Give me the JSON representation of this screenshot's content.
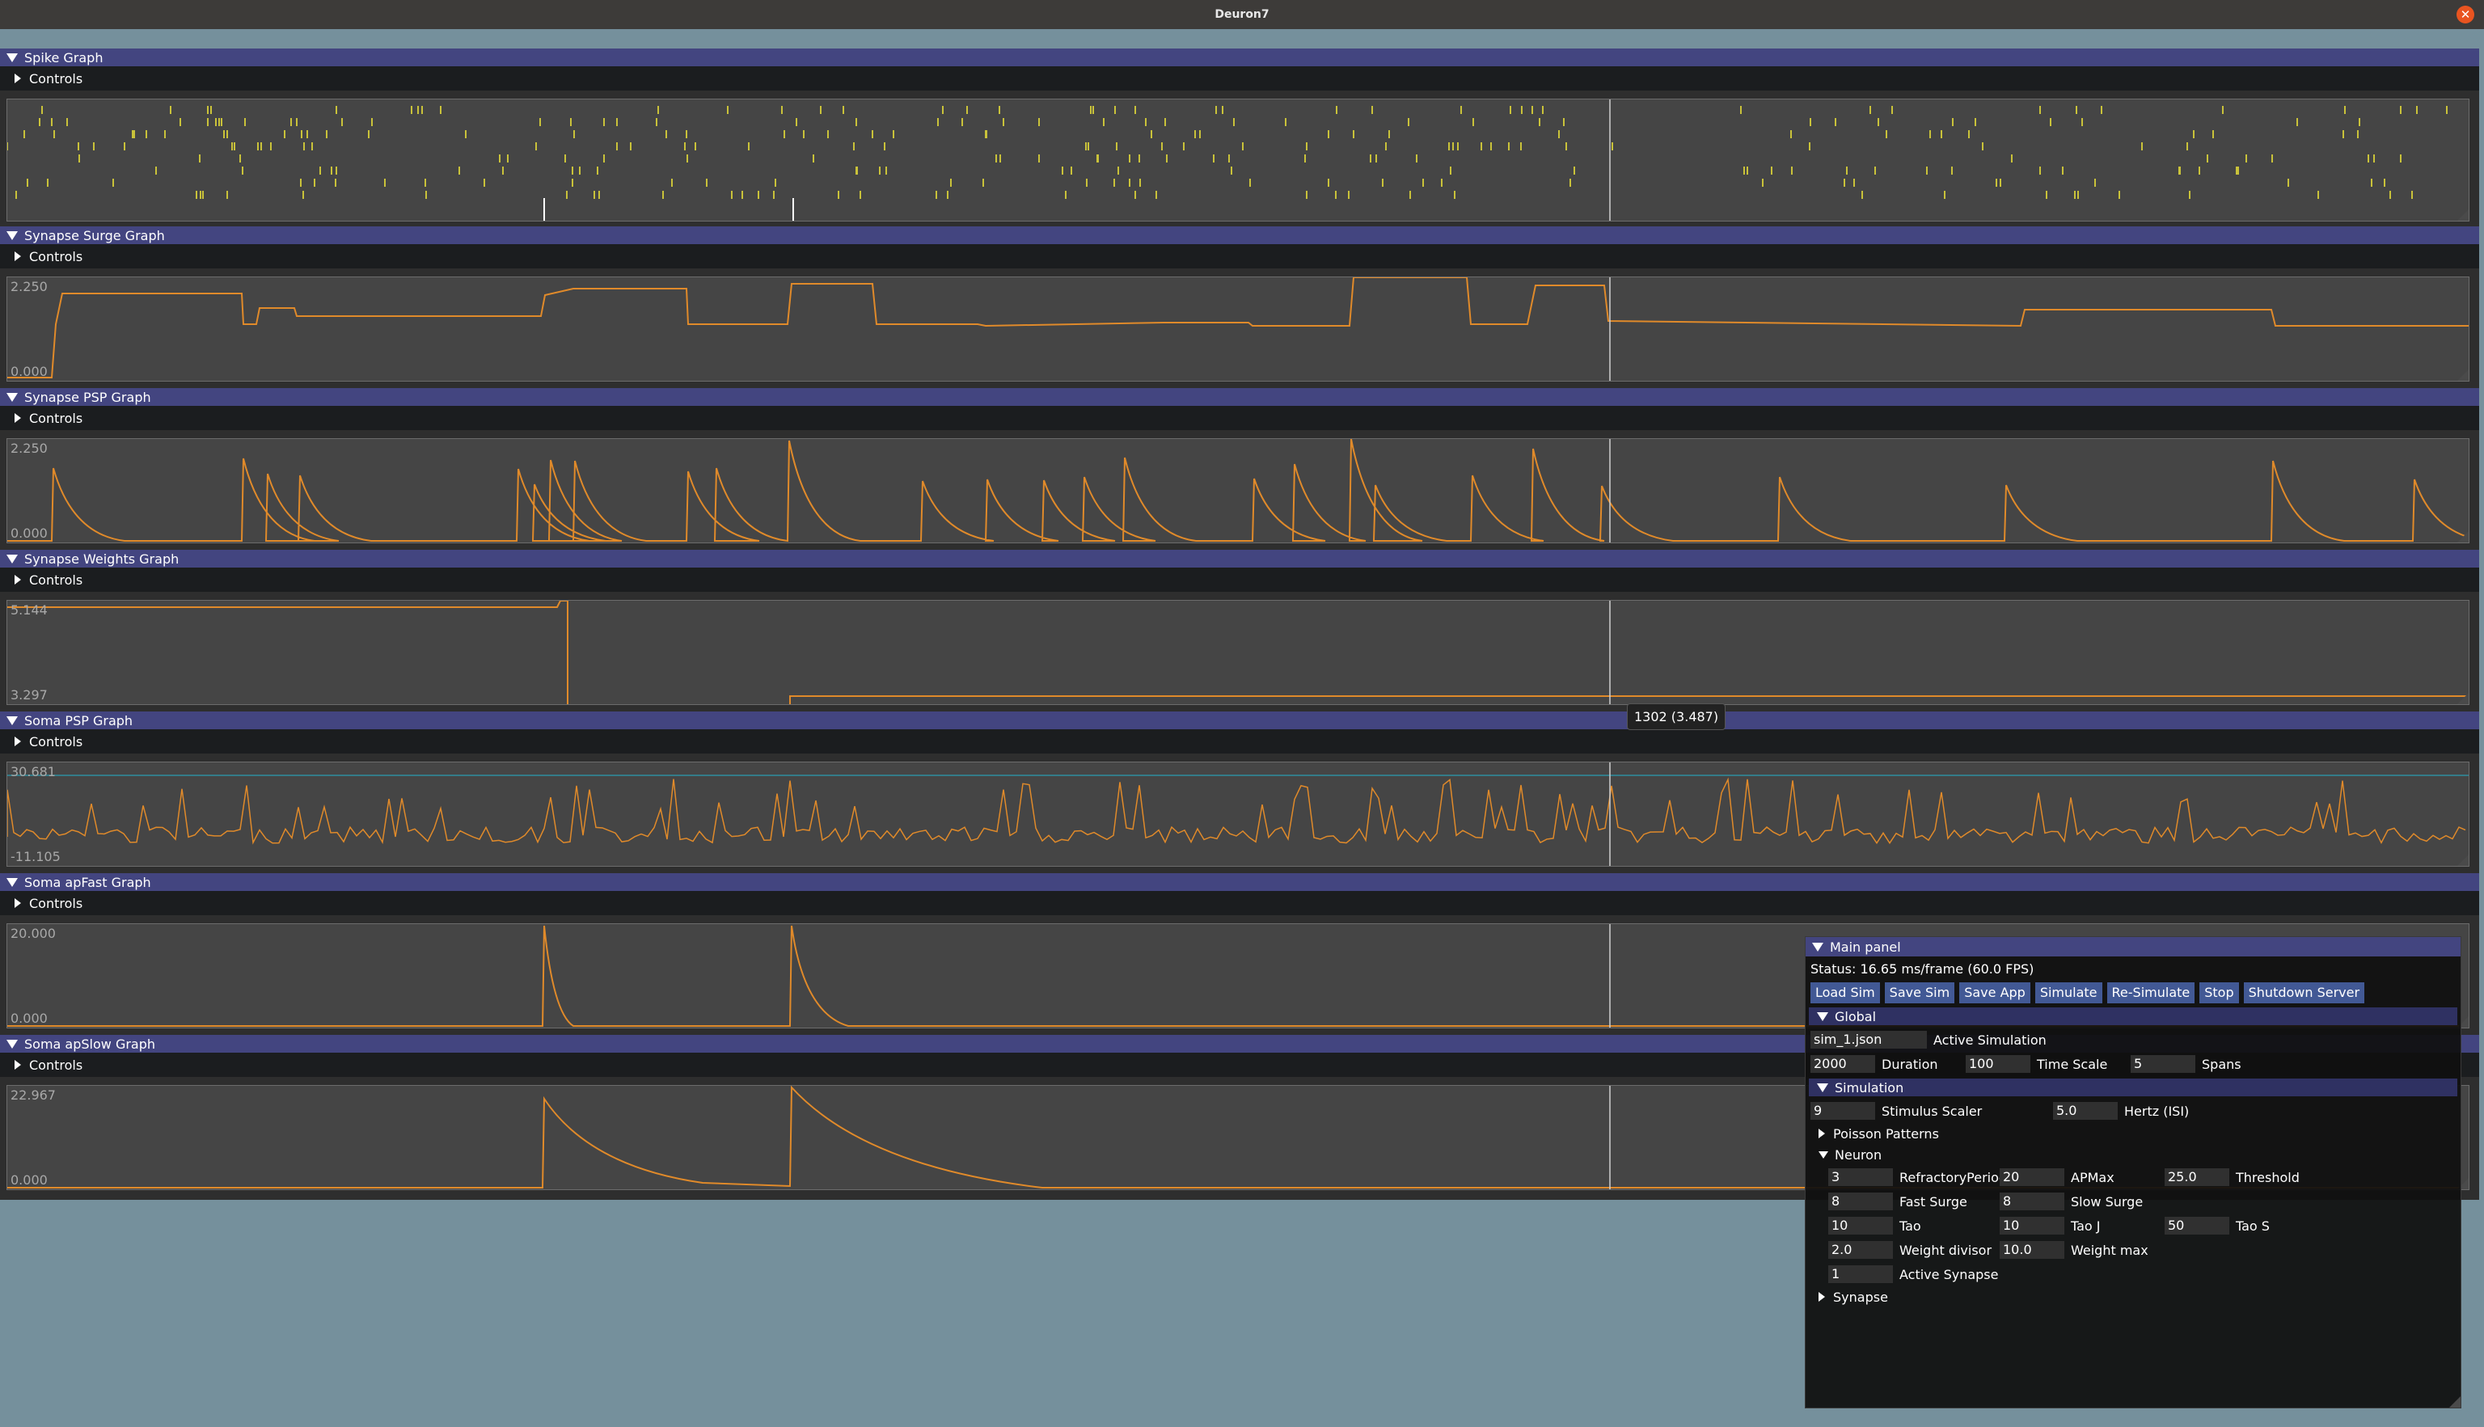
{
  "window": {
    "title": "Deuron7"
  },
  "graphs": [
    {
      "name": "spike-graph",
      "title": "Spike Graph",
      "controls": "Controls",
      "ymax": "",
      "ymin": "",
      "type": "spike",
      "height": 150
    },
    {
      "name": "synapse-surge-graph",
      "title": "Synapse Surge Graph",
      "controls": "Controls",
      "ymax": "2.250",
      "ymin": "0.000",
      "type": "surge",
      "height": 130
    },
    {
      "name": "synapse-psp-graph",
      "title": "Synapse PSP Graph",
      "controls": "Controls",
      "ymax": "2.250",
      "ymin": "0.000",
      "type": "psp",
      "height": 130
    },
    {
      "name": "synapse-weights-graph",
      "title": "Synapse Weights Graph",
      "controls": "Controls",
      "ymax": "5.144",
      "ymin": "3.297",
      "type": "weights",
      "height": 130
    },
    {
      "name": "soma-psp-graph",
      "title": "Soma PSP Graph",
      "controls": "Controls",
      "ymax": "30.681",
      "ymin": "-11.105",
      "type": "soma",
      "height": 130
    },
    {
      "name": "soma-apfast-graph",
      "title": "Soma apFast Graph",
      "controls": "Controls",
      "ymax": "20.000",
      "ymin": "0.000",
      "type": "apfast",
      "height": 130
    },
    {
      "name": "soma-apslow-graph",
      "title": "Soma apSlow Graph",
      "controls": "Controls",
      "ymax": "22.967",
      "ymin": "0.000",
      "type": "apslow",
      "height": 130
    }
  ],
  "tooltip": "1302 (3.487)",
  "main_panel": {
    "title": "Main panel",
    "status": "Status: 16.65 ms/frame (60.0 FPS)",
    "buttons": [
      "Load Sim",
      "Save Sim",
      "Save App",
      "Simulate",
      "Re-Simulate",
      "Stop",
      "Shutdown Server"
    ],
    "global": {
      "title": "Global",
      "active_sim_value": "sim_1.json",
      "active_sim_label": "Active Simulation",
      "duration_value": "2000",
      "duration_label": "Duration",
      "timescale_value": "100",
      "timescale_label": "Time Scale",
      "spans_value": "5",
      "spans_label": "Spans"
    },
    "simulation": {
      "title": "Simulation",
      "stimulus_value": "9",
      "stimulus_label": "Stimulus Scaler",
      "hertz_value": "5.0",
      "hertz_label": "Hertz (ISI)",
      "poisson_label": "Poisson Patterns",
      "neuron_label": "Neuron",
      "refractory_value": "3",
      "refractory_label": "RefractoryPeriod",
      "apmax_value": "20",
      "apmax_label": "APMax",
      "threshold_value": "25.0",
      "threshold_label": "Threshold",
      "fast_surge_value": "8",
      "fast_surge_label": "Fast Surge",
      "slow_surge_value": "8",
      "slow_surge_label": "Slow Surge",
      "tao_value": "10",
      "tao_label": "Tao",
      "tao_j_value": "10",
      "tao_j_label": "Tao J",
      "tao_s_value": "50",
      "tao_s_label": "Tao S",
      "weight_divisor_value": "2.0",
      "weight_divisor_label": "Weight divisor",
      "weight_max_value": "10.0",
      "weight_max_label": "Weight max",
      "active_synapse_value": "1",
      "active_synapse_label": "Active Synapse",
      "synapse_label": "Synapse"
    }
  },
  "colors": {
    "accent_header": "#434580",
    "trace": "#e08a2a",
    "spike": "#c9c23a",
    "cursor": "#d0d0d0",
    "threshold": "#2f8fa0"
  }
}
